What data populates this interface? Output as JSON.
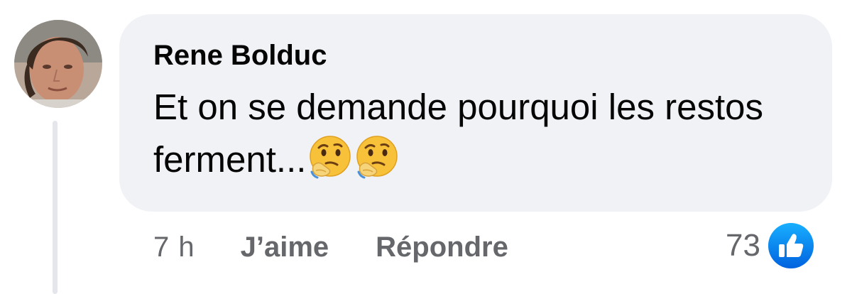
{
  "comment": {
    "author": "Rene Bolduc",
    "text": "Et on se demande pourquoi les restos ferment...",
    "emojis": [
      "thinking-face-icon",
      "thinking-face-icon"
    ]
  },
  "actions": {
    "time": "7 h",
    "like_label": "J’aime",
    "reply_label": "Répondre"
  },
  "reactions": {
    "count": "73",
    "type": "like-reaction-icon"
  },
  "colors": {
    "bubble": "#f0f2f5",
    "secondary_text": "#65676b",
    "like_blue": "#1877f2"
  }
}
